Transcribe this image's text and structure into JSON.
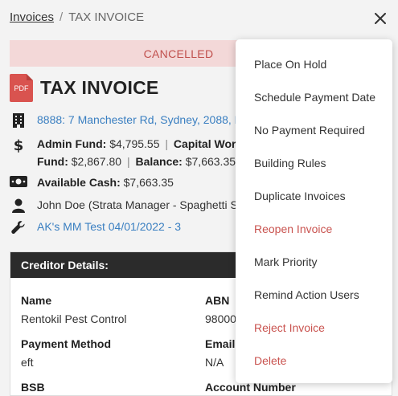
{
  "breadcrumb": {
    "parent": "Invoices",
    "separator": "/",
    "current": "TAX INVOICE"
  },
  "status_banner": "CANCELLED",
  "invoice": {
    "pdf_label": "PDF",
    "title": "TAX INVOICE"
  },
  "details": {
    "address": "8888: 7 Manchester Rd, Sydney, 2088, N",
    "admin_fund_label": "Admin Fund:",
    "admin_fund_value": "$4,795.55",
    "divider": "|",
    "capital_works_label": "Capital Work",
    "fund_label": "Fund:",
    "fund_value": "$2,867.80",
    "balance_label": "Balance:",
    "balance_value": "$7,663.35",
    "available_cash_label": "Available Cash:",
    "available_cash_value": "$7,663.35",
    "manager": "John Doe (Strata Manager - Spaghetti St",
    "work_order": "AK's MM Test 04/01/2022 - 3"
  },
  "creditor": {
    "header": "Creditor Details:",
    "name_label": "Name",
    "name_value": "Rentokil Pest Control",
    "abn_label": "ABN",
    "abn_value": "98000",
    "payment_method_label": "Payment Method",
    "payment_method_value": "eft",
    "email_label": "Email",
    "email_value": "N/A",
    "bsb_label": "BSB",
    "account_number_label": "Account Number"
  },
  "menu": {
    "items": [
      {
        "label": "Place On Hold"
      },
      {
        "label": "Schedule Payment Date"
      },
      {
        "label": "No Payment Required"
      },
      {
        "label": "Building Rules"
      },
      {
        "label": "Duplicate Invoices"
      },
      {
        "label": "Reopen Invoice"
      },
      {
        "label": "Mark Priority"
      },
      {
        "label": "Remind Action Users"
      },
      {
        "label": "Reject Invoice"
      },
      {
        "label": "Delete"
      }
    ]
  },
  "colors": {
    "link": "#3a7fc1",
    "danger": "#c9534f",
    "banner_bg": "#f3d8d8",
    "header_dark": "#2b2b2b"
  }
}
